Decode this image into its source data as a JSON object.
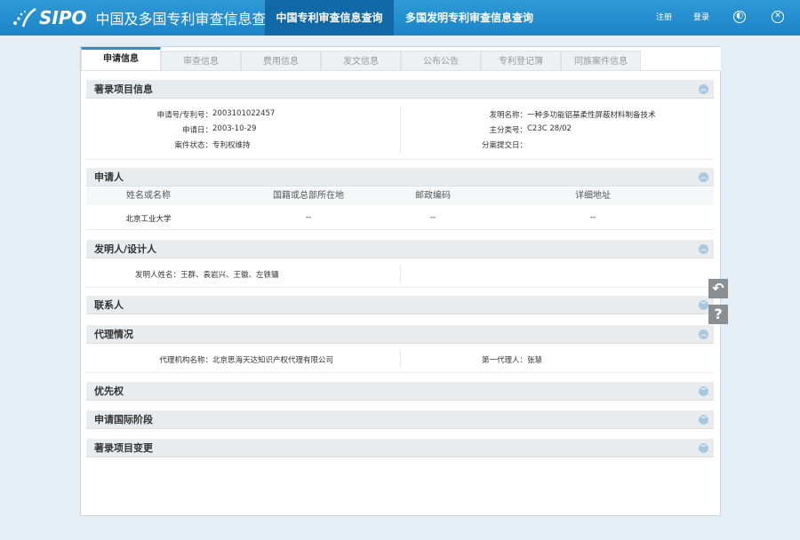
{
  "header": {
    "logo_text": "SIPO",
    "site_title": "中国及多国专利审查信息查询",
    "nav": [
      "中国专利审查信息查询",
      "多国发明专利审查信息查询"
    ],
    "register": "注册",
    "login": "登录"
  },
  "tabs": [
    "申请信息",
    "审查信息",
    "费用信息",
    "发文信息",
    "公布公告",
    "专利登记簿",
    "同族案件信息"
  ],
  "bibliographic": {
    "title": "著录项目信息",
    "app_no_label": "申请号/专利号：",
    "app_no": "2003101022457",
    "filing_date_label": "申请日：",
    "filing_date": "2003-10-29",
    "status_label": "案件状态：",
    "status": "专利权维持",
    "invention_name_label": "发明名称：",
    "invention_name": "一种多功能铝基柔性屏蔽材料制备技术",
    "main_class_label": "主分类号：",
    "main_class": "C23C 28/02",
    "divisional_label": "分案提交日："
  },
  "applicant": {
    "title": "申请人",
    "columns": [
      "姓名或名称",
      "国籍或总部所在地",
      "邮政编码",
      "详细地址"
    ],
    "rows": [
      [
        "北京工业大学",
        "--",
        "--",
        "--"
      ]
    ]
  },
  "inventor": {
    "title": "发明人/设计人",
    "label": "发明人姓名：",
    "value": "王群、袁岩兴、王徽、左铁镛"
  },
  "contact": {
    "title": "联系人"
  },
  "agency": {
    "title": "代理情况",
    "agency_label": "代理机构名称：",
    "agency_value": "北京思海天达知识产权代理有限公司",
    "agent_label": "第一代理人：",
    "agent_value": "张慧"
  },
  "priority": {
    "title": "优先权"
  },
  "intl_phase": {
    "title": "申请国际阶段"
  },
  "biblio_change": {
    "title": "著录项目变更"
  },
  "colors": {
    "header": "#1c84c7",
    "active_nav": "#1169a8",
    "toggle": "#a9c8e0"
  }
}
